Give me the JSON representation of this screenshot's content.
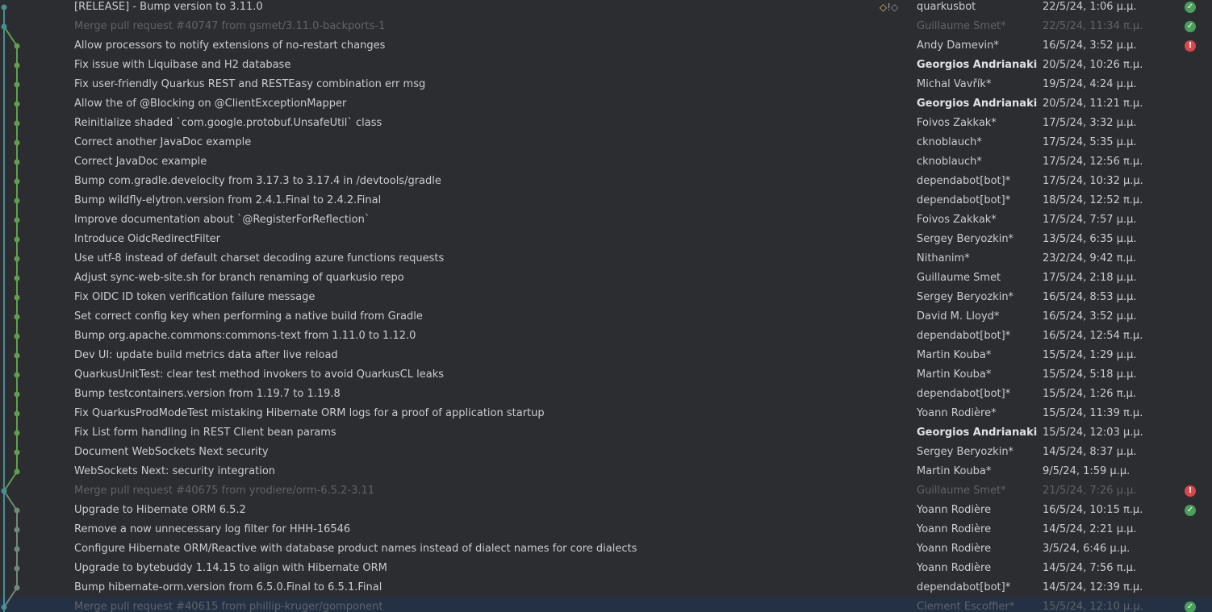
{
  "colors": {
    "background": "#2b2d30",
    "selected_row": "#243145",
    "graph_main": "#4a8f94",
    "graph_branch_a": "#5fa04e",
    "graph_branch_b": "#6f8a7a",
    "status_ok": "#4aa05a",
    "status_fail": "#d9474b",
    "tag_color": "#e3c35a"
  },
  "commits": [
    {
      "subject": "[RELEASE] - Bump version to 3.11.0",
      "author": "quarkusbot",
      "date": "22/5/24, 1:06 μ.μ.",
      "status": "ok",
      "tags": "tag-icons",
      "lane": "main",
      "merge": false,
      "bold": false
    },
    {
      "subject": "Merge pull request #40747 from gsmet/3.11.0-backports-1",
      "author": "Guillaume Smet*",
      "date": "22/5/24, 11:34 π.μ.",
      "status": "ok",
      "lane": "main",
      "merge": true,
      "bold": false
    },
    {
      "subject": "Allow processors to notify extensions of no-restart changes",
      "author": "Andy Damevin*",
      "date": "16/5/24, 3:52 μ.μ.",
      "status": "fail",
      "lane": "branch_a",
      "merge": false,
      "bold": false
    },
    {
      "subject": "Fix issue with Liquibase and H2 database",
      "author": "Georgios Andrianakis*",
      "date": "20/5/24, 10:26 π.μ.",
      "status": "none",
      "lane": "branch_a",
      "merge": false,
      "bold": true
    },
    {
      "subject": "Fix user-friendly Quarkus REST and RESTEasy combination err msg",
      "author": "Michal Vavřík*",
      "date": "19/5/24, 4:24 μ.μ.",
      "status": "none",
      "lane": "branch_a",
      "merge": false,
      "bold": false
    },
    {
      "subject": "Allow the of @Blocking on @ClientExceptionMapper",
      "author": "Georgios Andrianakis*",
      "date": "20/5/24, 11:21 π.μ.",
      "status": "none",
      "lane": "branch_a",
      "merge": false,
      "bold": true
    },
    {
      "subject": "Reinitialize shaded `com.google.protobuf.UnsafeUtil` class",
      "author": "Foivos Zakkak*",
      "date": "17/5/24, 3:32 μ.μ.",
      "status": "none",
      "lane": "branch_a",
      "merge": false,
      "bold": false
    },
    {
      "subject": "Correct another JavaDoc example",
      "author": "cknoblauch*",
      "date": "17/5/24, 5:35 μ.μ.",
      "status": "none",
      "lane": "branch_a",
      "merge": false,
      "bold": false
    },
    {
      "subject": "Correct JavaDoc example",
      "author": "cknoblauch*",
      "date": "17/5/24, 12:56 π.μ.",
      "status": "none",
      "lane": "branch_a",
      "merge": false,
      "bold": false
    },
    {
      "subject": "Bump com.gradle.develocity from 3.17.3 to 3.17.4 in /devtools/gradle",
      "author": "dependabot[bot]*",
      "date": "17/5/24, 10:32 μ.μ.",
      "status": "none",
      "lane": "branch_a",
      "merge": false,
      "bold": false
    },
    {
      "subject": "Bump wildfly-elytron.version from 2.4.1.Final to 2.4.2.Final",
      "author": "dependabot[bot]*",
      "date": "18/5/24, 12:52 π.μ.",
      "status": "none",
      "lane": "branch_a",
      "merge": false,
      "bold": false
    },
    {
      "subject": "Improve documentation about `@RegisterForReflection`",
      "author": "Foivos Zakkak*",
      "date": "17/5/24, 7:57 μ.μ.",
      "status": "none",
      "lane": "branch_a",
      "merge": false,
      "bold": false
    },
    {
      "subject": "Introduce OidcRedirectFilter",
      "author": "Sergey Beryozkin*",
      "date": "13/5/24, 6:35 μ.μ.",
      "status": "none",
      "lane": "branch_a",
      "merge": false,
      "bold": false
    },
    {
      "subject": "Use utf-8 instead of default charset decoding azure functions requests",
      "author": "Nithanim*",
      "date": "23/2/24, 9:42 π.μ.",
      "status": "none",
      "lane": "branch_a",
      "merge": false,
      "bold": false
    },
    {
      "subject": "Adjust sync-web-site.sh for branch renaming of quarkusio repo",
      "author": "Guillaume Smet",
      "date": "17/5/24, 2:18 μ.μ.",
      "status": "none",
      "lane": "branch_a",
      "merge": false,
      "bold": false
    },
    {
      "subject": "Fix OIDC ID token verification failure message",
      "author": "Sergey Beryozkin*",
      "date": "16/5/24, 8:53 μ.μ.",
      "status": "none",
      "lane": "branch_a",
      "merge": false,
      "bold": false
    },
    {
      "subject": "Set correct config key when performing a native build from Gradle",
      "author": "David M. Lloyd*",
      "date": "16/5/24, 3:52 μ.μ.",
      "status": "none",
      "lane": "branch_a",
      "merge": false,
      "bold": false
    },
    {
      "subject": "Bump org.apache.commons:commons-text from 1.11.0 to 1.12.0",
      "author": "dependabot[bot]*",
      "date": "16/5/24, 12:54 π.μ.",
      "status": "none",
      "lane": "branch_a",
      "merge": false,
      "bold": false
    },
    {
      "subject": "Dev UI: update build metrics data after live reload",
      "author": "Martin Kouba*",
      "date": "15/5/24, 1:29 μ.μ.",
      "status": "none",
      "lane": "branch_a",
      "merge": false,
      "bold": false
    },
    {
      "subject": "QuarkusUnitTest: clear test method invokers to avoid QuarkusCL leaks",
      "author": "Martin Kouba*",
      "date": "15/5/24, 5:18 μ.μ.",
      "status": "none",
      "lane": "branch_a",
      "merge": false,
      "bold": false
    },
    {
      "subject": "Bump testcontainers.version from 1.19.7 to 1.19.8",
      "author": "dependabot[bot]*",
      "date": "15/5/24, 1:26 π.μ.",
      "status": "none",
      "lane": "branch_a",
      "merge": false,
      "bold": false
    },
    {
      "subject": "Fix QuarkusProdModeTest mistaking Hibernate ORM logs for a proof of application startup",
      "author": "Yoann Rodière*",
      "date": "15/5/24, 11:39 π.μ.",
      "status": "none",
      "lane": "branch_a",
      "merge": false,
      "bold": false
    },
    {
      "subject": "Fix List form handling in REST Client bean params",
      "author": "Georgios Andrianakis*",
      "date": "15/5/24, 12:03 μ.μ.",
      "status": "none",
      "lane": "branch_a",
      "merge": false,
      "bold": true
    },
    {
      "subject": "Document WebSockets Next security",
      "author": "Sergey Beryozkin*",
      "date": "14/5/24, 8:37 μ.μ.",
      "status": "none",
      "lane": "branch_a",
      "merge": false,
      "bold": false
    },
    {
      "subject": "WebSockets Next: security integration",
      "author": "Martin Kouba*",
      "date": "9/5/24, 1:59 μ.μ.",
      "status": "none",
      "lane": "branch_a",
      "merge": false,
      "bold": false
    },
    {
      "subject": "Merge pull request #40675 from yrodiere/orm-6.5.2-3.11",
      "author": "Guillaume Smet*",
      "date": "21/5/24, 7:26 μ.μ.",
      "status": "fail",
      "lane": "main",
      "merge": true,
      "bold": false
    },
    {
      "subject": "Upgrade to Hibernate ORM 6.5.2",
      "author": "Yoann Rodière",
      "date": "16/5/24, 10:15 π.μ.",
      "status": "ok",
      "lane": "branch_b",
      "merge": false,
      "bold": false
    },
    {
      "subject": "Remove a now unnecessary log filter for HHH-16546",
      "author": "Yoann Rodière",
      "date": "14/5/24, 2:21 μ.μ.",
      "status": "none",
      "lane": "branch_b",
      "merge": false,
      "bold": false
    },
    {
      "subject": "Configure Hibernate ORM/Reactive with database product names instead of dialect names for core dialects",
      "author": "Yoann Rodière",
      "date": "3/5/24, 6:46 μ.μ.",
      "status": "none",
      "lane": "branch_b",
      "merge": false,
      "bold": false
    },
    {
      "subject": "Upgrade to bytebuddy 1.14.15 to align with Hibernate ORM",
      "author": "Yoann Rodière",
      "date": "14/5/24, 7:56 π.μ.",
      "status": "none",
      "lane": "branch_b",
      "merge": false,
      "bold": false
    },
    {
      "subject": "Bump hibernate-orm.version from 6.5.0.Final to 6.5.1.Final",
      "author": "dependabot[bot]*",
      "date": "14/5/24, 12:39 π.μ.",
      "status": "none",
      "lane": "branch_b",
      "merge": false,
      "bold": false
    },
    {
      "subject": "Merge pull request #40615 from phillip-kruger/gomponent",
      "author": "Clement Escoffier*",
      "date": "15/5/24, 12:10 μ.μ.",
      "status": "ok",
      "lane": "main",
      "merge": true,
      "bold": false,
      "selected": true
    }
  ]
}
